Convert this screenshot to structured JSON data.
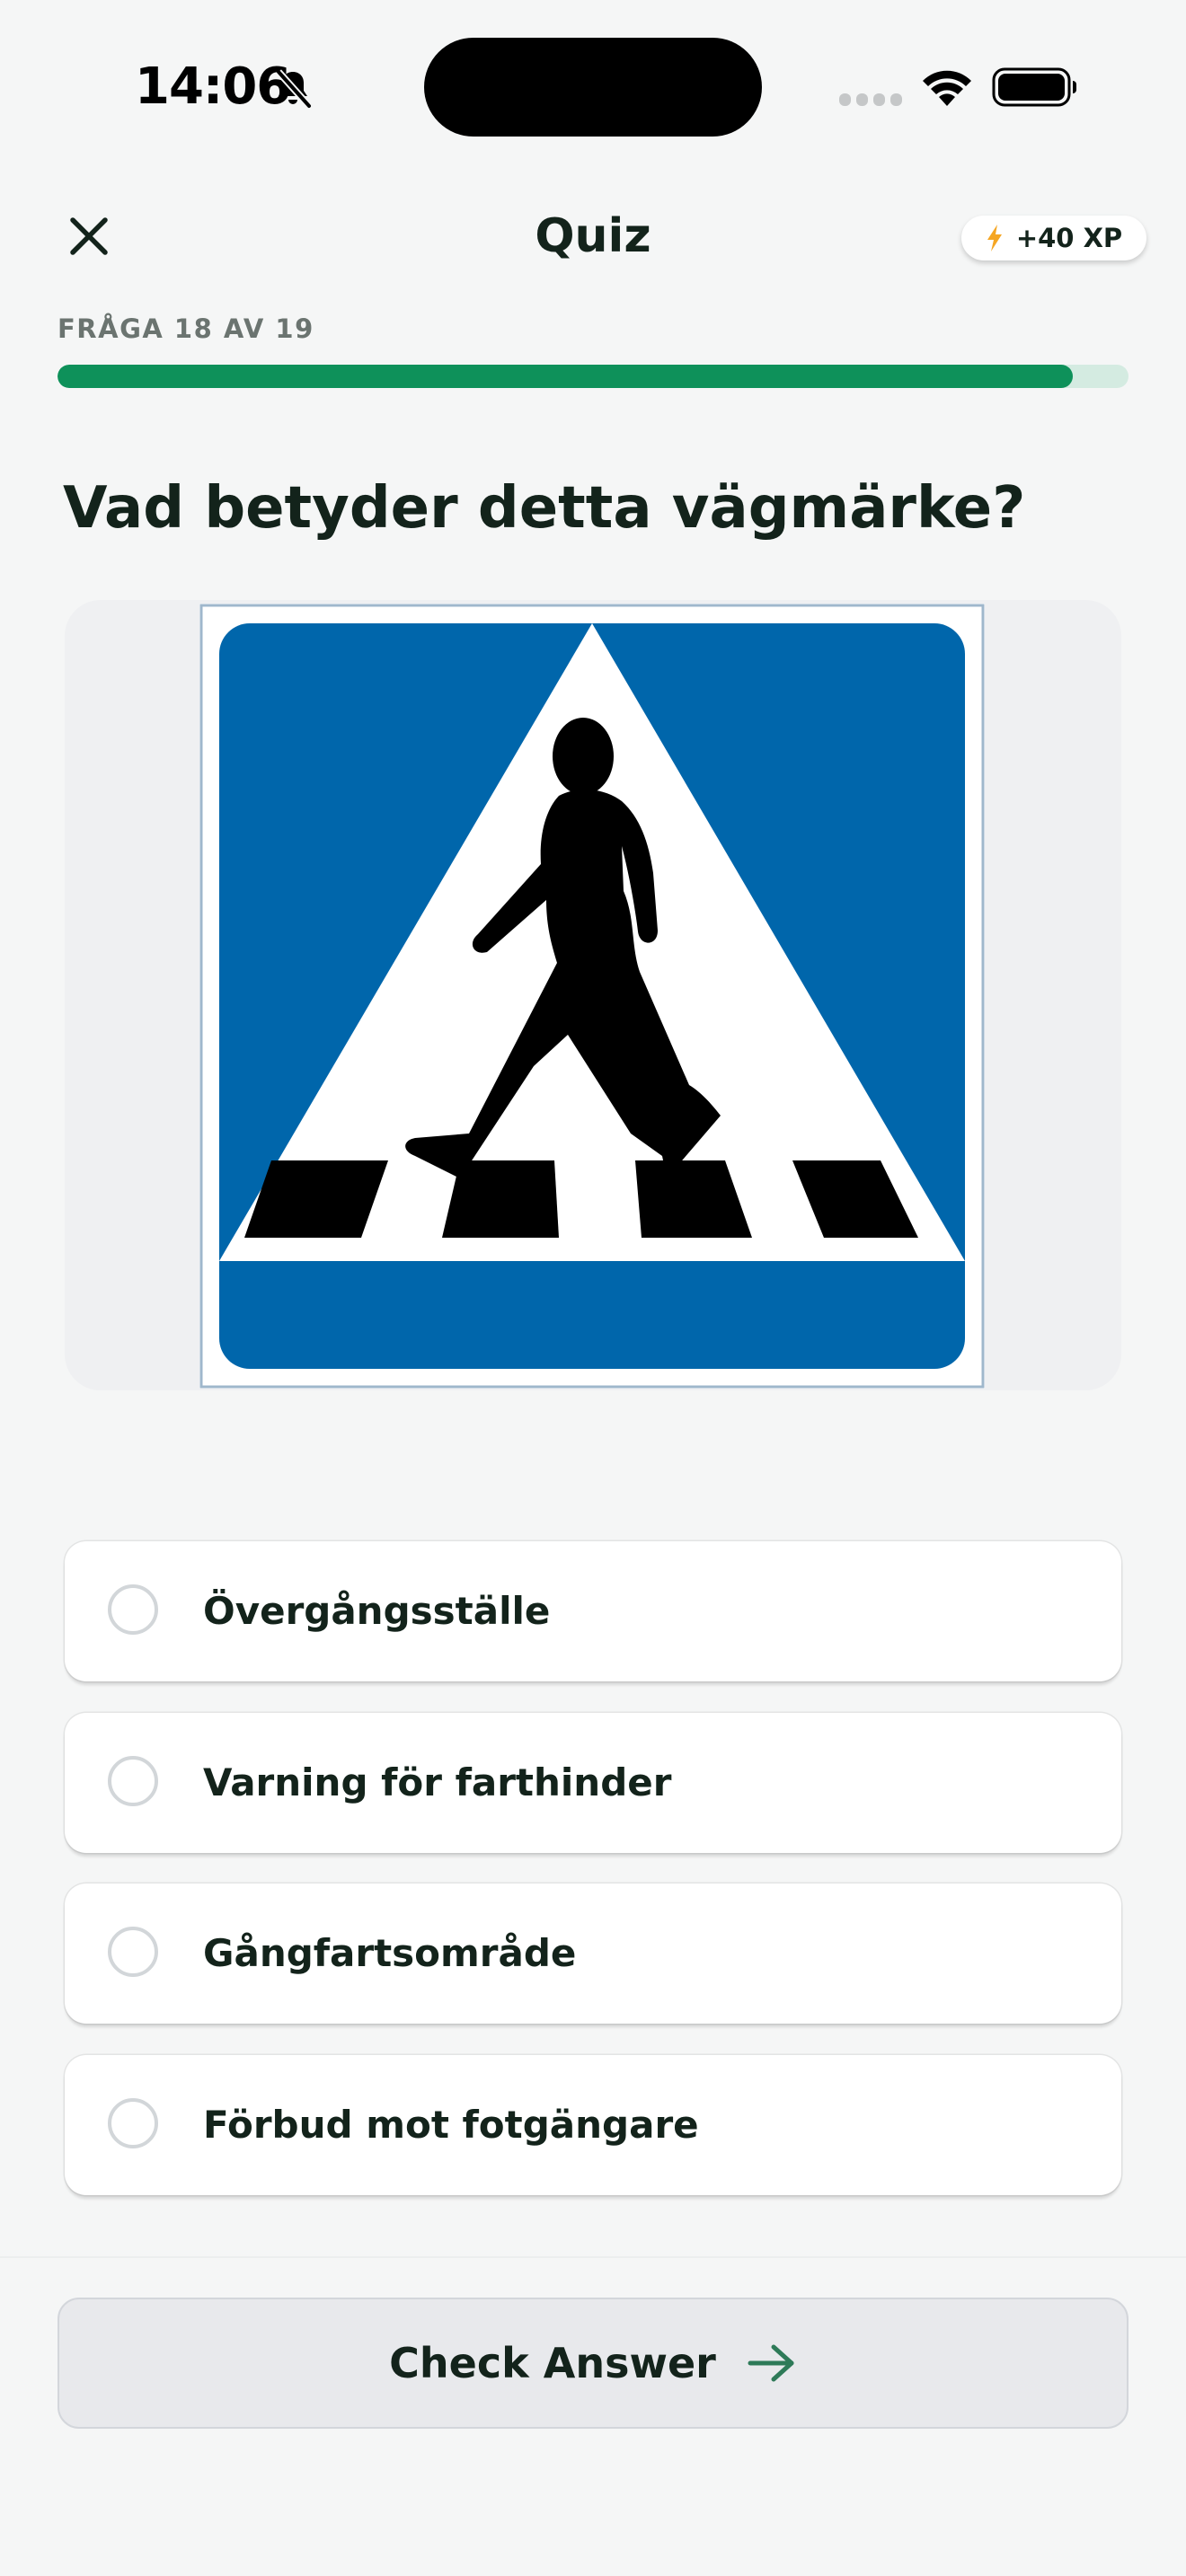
{
  "status_bar": {
    "time": "14:06",
    "icons": [
      "bell-slash-icon",
      "cellular-signal-icon",
      "wifi-icon",
      "battery-icon"
    ]
  },
  "header": {
    "close_icon": "close-icon",
    "title": "Quiz",
    "xp_icon": "lightning-icon",
    "xp_label": "+40 XP"
  },
  "progress": {
    "label": "FRÅGA 18 AV 19",
    "current": 18,
    "total": 19,
    "fraction": 0.948
  },
  "question": {
    "title": "Vad betyder detta vägmärke?",
    "image": "pedestrian-crossing-sign"
  },
  "options": [
    {
      "label": "Övergångsställe",
      "selected": false
    },
    {
      "label": "Varning för farthinder",
      "selected": false
    },
    {
      "label": "Gångfartsområde",
      "selected": false
    },
    {
      "label": "Förbud mot fotgängare",
      "selected": false
    }
  ],
  "footer": {
    "check_label": "Check Answer",
    "arrow_icon": "arrow-right-icon"
  },
  "colors": {
    "accent": "#0e915a",
    "track": "#d4ebe1",
    "sign_blue": "#0066ab",
    "xp_bolt": "#f5a623",
    "background": "#f5f6f6"
  }
}
